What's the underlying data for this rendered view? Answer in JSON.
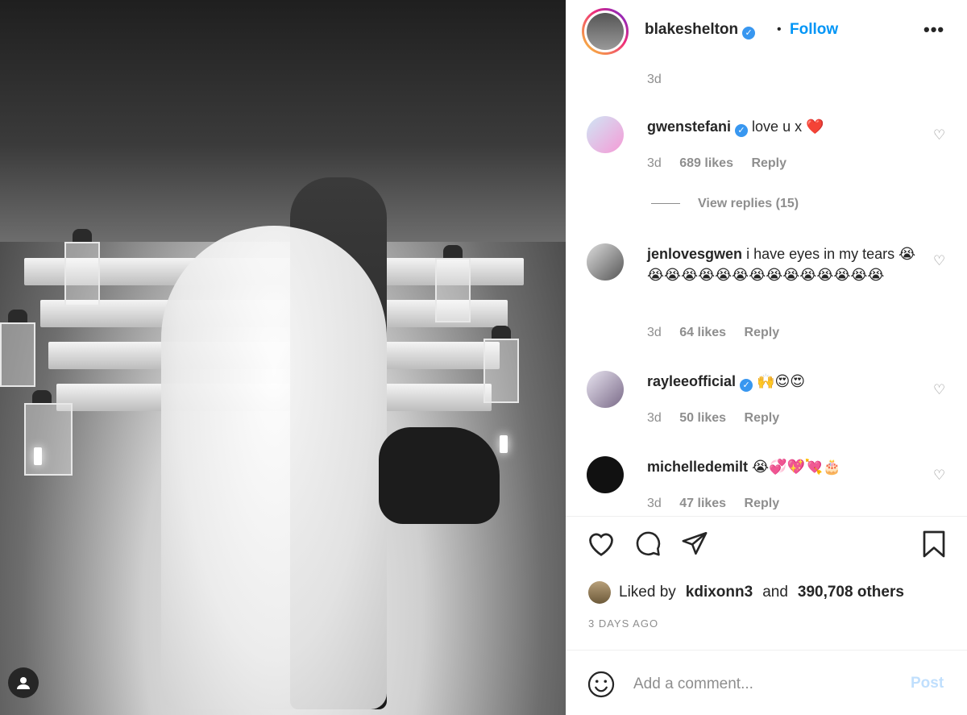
{
  "post": {
    "image_subject": "wedding-photo-black-and-white",
    "author": {
      "username": "blakeshelton",
      "verified": true,
      "follow_label": "Follow"
    },
    "caption_time": "3d",
    "more_icon": "more-horizontal-icon"
  },
  "comments": [
    {
      "username": "gwenstefani",
      "verified": true,
      "text": "love u x ❤️",
      "time": "3d",
      "likes": "689 likes",
      "reply": "Reply"
    },
    {
      "username": "jenlovesgwen",
      "verified": false,
      "text": "i have eyes in my tears 😭😭😭😭😭😭😭😭😭😭😭😭😭😭😭",
      "time": "3d",
      "likes": "64 likes",
      "reply": "Reply"
    },
    {
      "username": "rayleeofficial",
      "verified": true,
      "text": "🙌😍😍",
      "time": "3d",
      "likes": "50 likes",
      "reply": "Reply"
    },
    {
      "username": "michelledemilt",
      "verified": false,
      "text": "😭💞💖💘🎂",
      "time": "3d",
      "likes": "47 likes",
      "reply": "Reply"
    }
  ],
  "view_replies": "View replies (15)",
  "actions": [
    "heart-icon",
    "comment-icon",
    "share-icon",
    "bookmark-icon"
  ],
  "likes": {
    "prefix": "Liked by",
    "user": "kdixonn3",
    "joiner": "and",
    "others": "390,708 others"
  },
  "date": "3 DAYS AGO",
  "add_comment": {
    "placeholder": "Add a comment...",
    "post_label": "Post"
  },
  "colors": {
    "accent": "#0095f6",
    "verified": "#3897f0",
    "muted": "#8e8e8e",
    "text": "#262626"
  }
}
